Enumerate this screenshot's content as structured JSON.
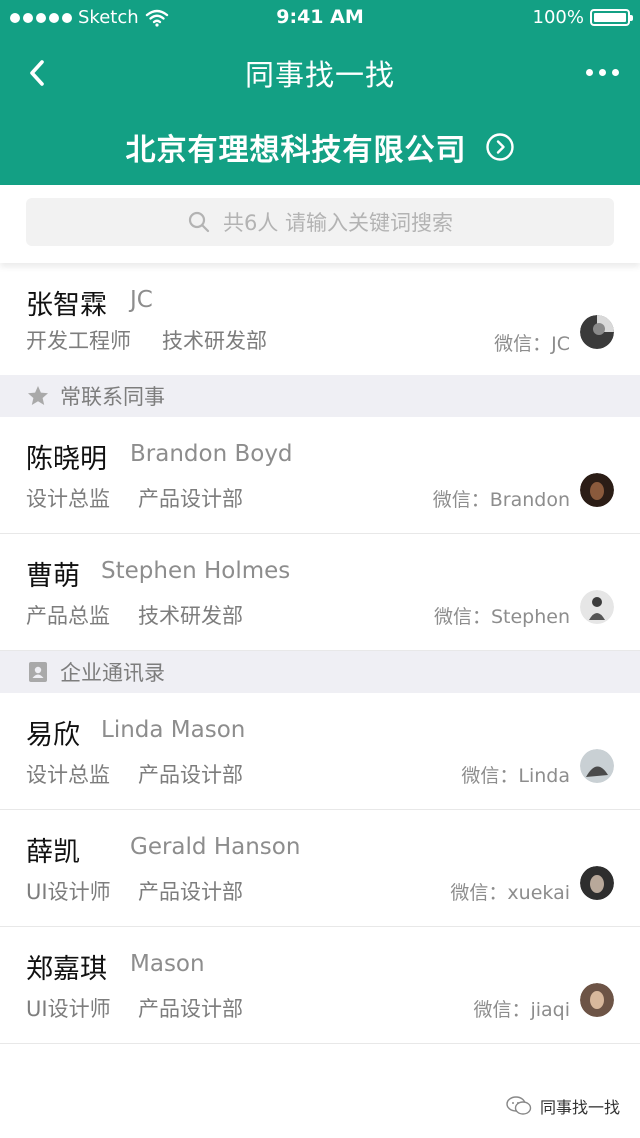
{
  "status": {
    "carrier": "Sketch",
    "time": "9:41 AM",
    "battery": "100%"
  },
  "nav": {
    "title": "同事找一找"
  },
  "company": {
    "name": "北京有理想科技有限公司"
  },
  "search": {
    "placeholder": "共6人 请输入关键词搜索"
  },
  "me": {
    "name": "张智霖",
    "ename": "JC",
    "role": "开发工程师",
    "dept": "技术研发部",
    "wechat": "微信：JC"
  },
  "sections": {
    "frequent": {
      "label": "常联系同事",
      "icon": "star-icon"
    },
    "directory": {
      "label": "企业通讯录",
      "icon": "contacts-book-icon"
    }
  },
  "frequent": [
    {
      "name": "陈晓明",
      "ename": "Brandon Boyd",
      "role": "设计总监",
      "dept": "产品设计部",
      "wechat": "微信：Brandon"
    },
    {
      "name": "曹萌",
      "ename": "Stephen Holmes",
      "role": "产品总监",
      "dept": "技术研发部",
      "wechat": "微信：Stephen"
    }
  ],
  "directory": [
    {
      "name": "易欣",
      "ename": "Linda Mason",
      "role": "设计总监",
      "dept": "产品设计部",
      "wechat": "微信：Linda"
    },
    {
      "name": "薛凯",
      "ename": "Gerald Hanson",
      "role": "UI设计师",
      "dept": "产品设计部",
      "wechat": "微信：xuekai"
    },
    {
      "name": "郑嘉琪",
      "ename": "Mason",
      "role": "UI设计师",
      "dept": "产品设计部",
      "wechat": "微信：jiaqi"
    }
  ],
  "footer": {
    "label": "同事找一找"
  },
  "colors": {
    "brand": "#13a084",
    "section_bg": "#efeff4"
  }
}
